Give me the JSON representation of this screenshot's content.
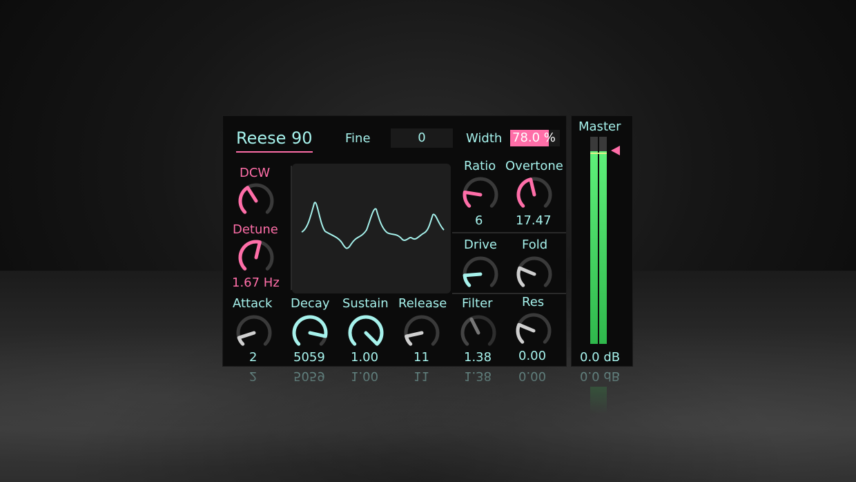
{
  "device": {
    "name": "Reese 90"
  },
  "header": {
    "fine_label": "Fine",
    "fine_value": "0",
    "width_label": "Width",
    "width_value": "78.0 %"
  },
  "oscillator": {
    "dcw": {
      "label": "DCW",
      "level": 0.38
    },
    "detune": {
      "label": "Detune",
      "value": "1.67 Hz",
      "level": 0.55
    },
    "waveform_icon": "waveform-display"
  },
  "harmonics": {
    "ratio": {
      "label": "Ratio",
      "value": "6",
      "level": 0.2
    },
    "overtone": {
      "label": "Overtone",
      "value": "17.47",
      "level": 0.45
    },
    "drive": {
      "label": "Drive",
      "level": 0.15
    },
    "fold": {
      "label": "Fold",
      "level": 0.25
    }
  },
  "envelope": {
    "attack": {
      "label": "Attack",
      "value": "2",
      "level": 0.1
    },
    "decay": {
      "label": "Decay",
      "value": "5059",
      "level": 0.88
    },
    "sustain": {
      "label": "Sustain",
      "value": "1.00",
      "level": 1.0
    },
    "release": {
      "label": "Release",
      "value": "11",
      "level": 0.12
    }
  },
  "filter": {
    "filter": {
      "label": "Filter",
      "value": "1.38",
      "level": 0.4
    },
    "res": {
      "label": "Res",
      "value": "0.00",
      "level": 0.25
    }
  },
  "master": {
    "label": "Master",
    "value": "0.0 dB",
    "level": 0.93
  },
  "colors": {
    "accent": "#ff6ea8",
    "cyan": "#a6f2ec",
    "knob_grey": "#cfcfcf",
    "meter_green": "#3ee05a"
  }
}
